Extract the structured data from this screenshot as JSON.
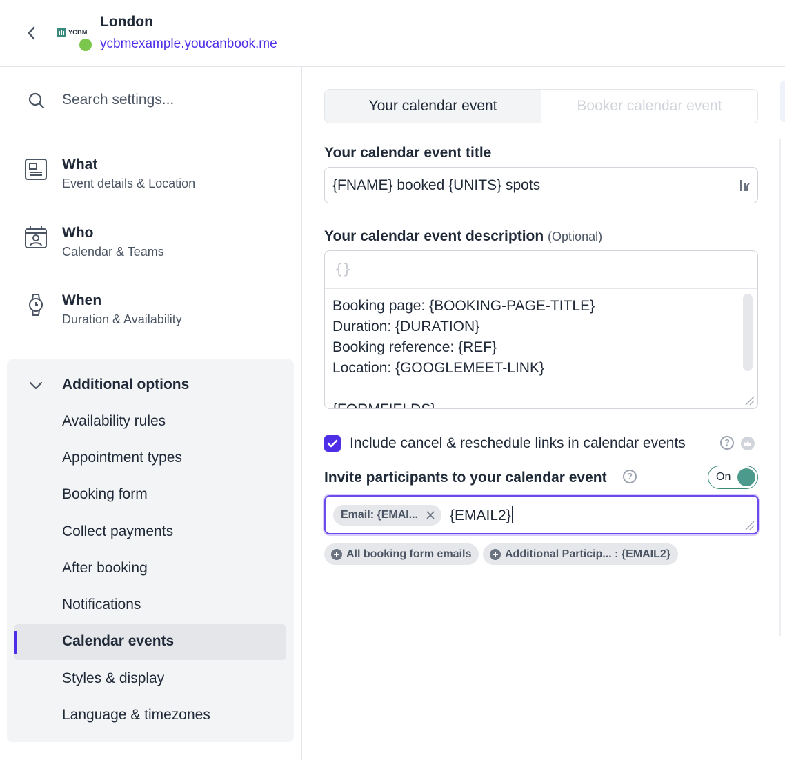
{
  "header": {
    "title": "London",
    "url": "ycbmexample.youcanbook.me",
    "logo_text": "YCBM",
    "status_color": "#7bc74d"
  },
  "sidebar": {
    "search_placeholder": "Search settings...",
    "nav": [
      {
        "title": "What",
        "subtitle": "Event details & Location",
        "icon": "document-icon"
      },
      {
        "title": "Who",
        "subtitle": "Calendar & Teams",
        "icon": "calendar-person-icon"
      },
      {
        "title": "When",
        "subtitle": "Duration & Availability",
        "icon": "watch-icon"
      }
    ],
    "additional": {
      "title": "Additional options",
      "items": [
        "Availability rules",
        "Appointment types",
        "Booking form",
        "Collect payments",
        "After booking",
        "Notifications",
        "Calendar events",
        "Styles & display",
        "Language & timezones"
      ],
      "active": "Calendar events"
    }
  },
  "main": {
    "tabs": [
      "Your calendar event",
      "Booker calendar event"
    ],
    "title_label": "Your calendar event title",
    "title_value": "{FNAME} booked {UNITS} spots",
    "desc_label": "Your calendar event description",
    "desc_optional": "(Optional)",
    "desc_toolbar_icon": "{}",
    "desc_value": "Booking page: {BOOKING-PAGE-TITLE}\nDuration: {DURATION}\nBooking reference: {REF}\nLocation: {GOOGLEMEET-LINK}\n\n{FORMFIELDS}",
    "include_links_label": "Include cancel & reschedule links in calendar events",
    "include_links_checked": true,
    "invite_label": "Invite participants to your calendar event",
    "toggle_label": "On",
    "chip_label": "Email: {EMAI...",
    "typed_value": "{EMAIL2}",
    "suggestions": [
      "All booking form emails",
      "Additional Particip... : {EMAIL2}"
    ],
    "accent_color": "#4f2ee8",
    "toggle_color": "#4b9a8c"
  }
}
